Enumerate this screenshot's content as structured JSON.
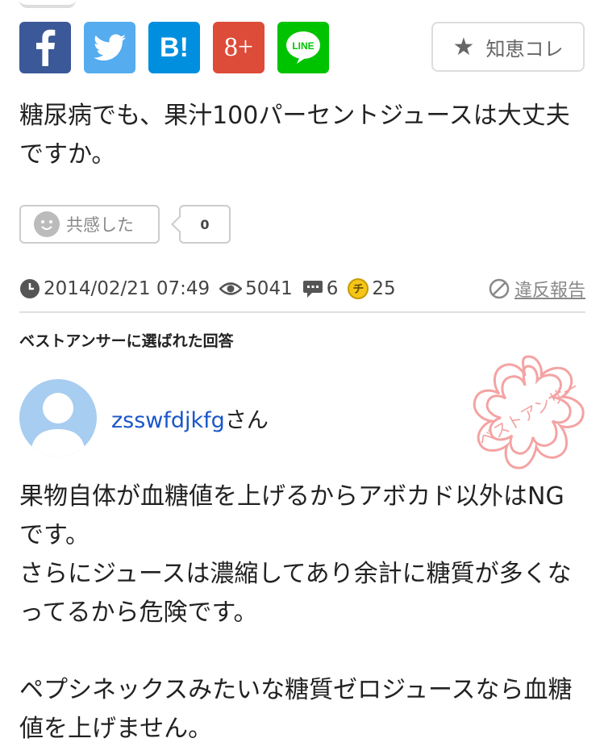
{
  "share": {
    "facebook_icon": "facebook-icon",
    "twitter_icon": "twitter-icon",
    "hatena_label": "B!",
    "google_plus_label": "8+",
    "line_label": "LINE",
    "chie_kore_label": "知恵コレ"
  },
  "question": {
    "text": "糖尿病でも、果汁100パーセントジュースは大丈夫ですか。",
    "empathy_label": "共感した",
    "empathy_count": "0"
  },
  "meta": {
    "datetime": "2014/02/21 07:49",
    "views": "5041",
    "answers": "6",
    "coins_badge": "チ",
    "coins": "25",
    "report_label": "違反報告"
  },
  "best_answer": {
    "heading": "ベストアンサーに選ばれた回答",
    "user_name": "zsswfdjkfg",
    "user_suffix": "さん",
    "stamp_text": "ベストアンサー",
    "body": "果物自体が血糖値を上げるからアボカド以外はNGです。\nさらにジュースは濃縮してあり余計に糖質が多くなってるから危険です。\n\nペプシネックスみたいな糖質ゼロジュースなら血糖値を上げません。"
  },
  "colors": {
    "facebook": "#3b5998",
    "twitter": "#55acee",
    "hatena": "#008fde",
    "google_plus": "#dd4b39",
    "line": "#00c300",
    "link": "#1a56c9",
    "stamp": "#f4a3a3",
    "coin": "#f5c518"
  }
}
